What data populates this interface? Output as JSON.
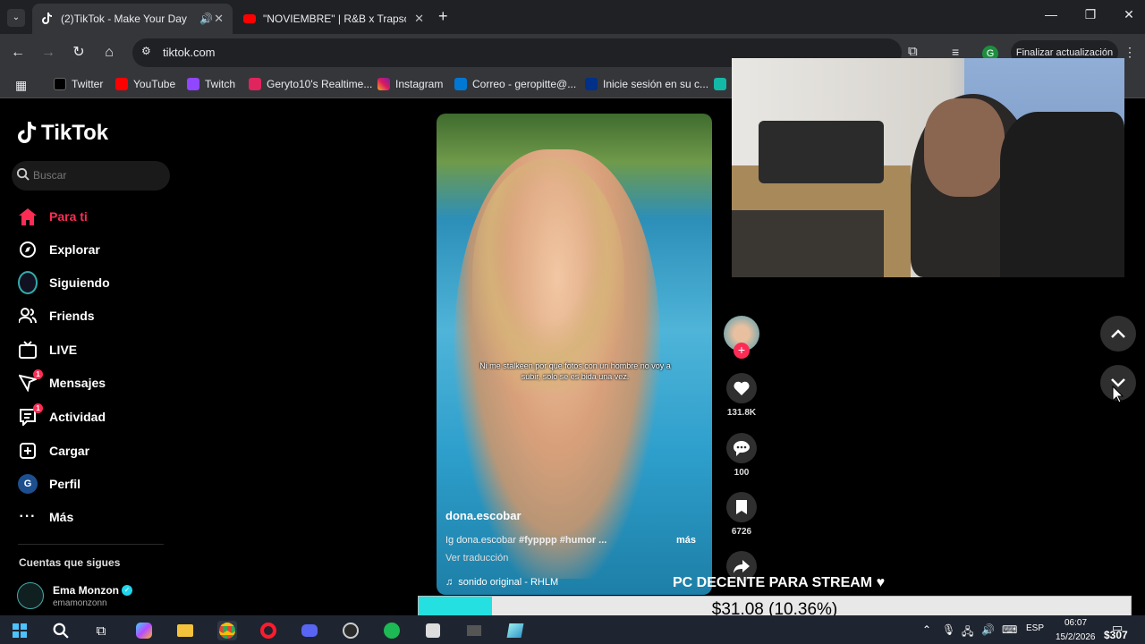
{
  "browser": {
    "tabs": [
      {
        "title": "(2)TikTok - Make Your Day",
        "active": true
      },
      {
        "title": "\"NOVIEMBRE\" | R&B x Trapsoul",
        "active": false
      }
    ],
    "url": "tiktok.com",
    "update_button": "Finalizar actualización",
    "profile_initial": "G",
    "bookmarks": [
      "Twitter",
      "YouTube",
      "Twitch",
      "Geryto10's Realtime...",
      "Instagram",
      "Correo - geropitte@...",
      "Inicie sesión en su c..."
    ]
  },
  "tiktok": {
    "logo": "TikTok",
    "search_placeholder": "Buscar",
    "nav": [
      {
        "label": "Para ti",
        "icon": "home-icon",
        "active": true
      },
      {
        "label": "Explorar",
        "icon": "compass-icon"
      },
      {
        "label": "Siguiendo",
        "icon": "following-avatar-icon"
      },
      {
        "label": "Friends",
        "icon": "friends-icon"
      },
      {
        "label": "LIVE",
        "icon": "live-icon"
      },
      {
        "label": "Mensajes",
        "icon": "messages-icon",
        "badge": "1"
      },
      {
        "label": "Actividad",
        "icon": "activity-icon",
        "badge": "1"
      },
      {
        "label": "Cargar",
        "icon": "upload-icon"
      },
      {
        "label": "Perfil",
        "icon": "profile-icon"
      },
      {
        "label": "Más",
        "icon": "more-icon"
      }
    ],
    "following_title": "Cuentas que sigues",
    "following": [
      {
        "name": "Ema Monzon",
        "handle": "emamonzonn",
        "verified": true
      }
    ],
    "video": {
      "caption": "Ni me stalkeen por que fotos con un hombre no voy a subir, solo se es bida una vez.",
      "author": "dona.escobar",
      "desc_prefix": "Ig dona.escobar",
      "hashtags": "#fypppp #humor ...",
      "more": "más",
      "translate": "Ver traducción",
      "sound": "sonido original - RHLM"
    },
    "actions": {
      "likes": "131.8K",
      "comments": "100",
      "saves": "6726"
    }
  },
  "overlay": {
    "donation_title": "PC DECENTE PARA STREAM ♥",
    "donation_text": "$31.08 (10.36%)",
    "donation_progress": 0.1036
  },
  "taskbar": {
    "lang": "ESP",
    "time": "06:07",
    "date": "15/2/2026",
    "corner_text": "$307"
  },
  "colors": {
    "accent": "#fe2c55",
    "progress": "#24e0e0"
  }
}
